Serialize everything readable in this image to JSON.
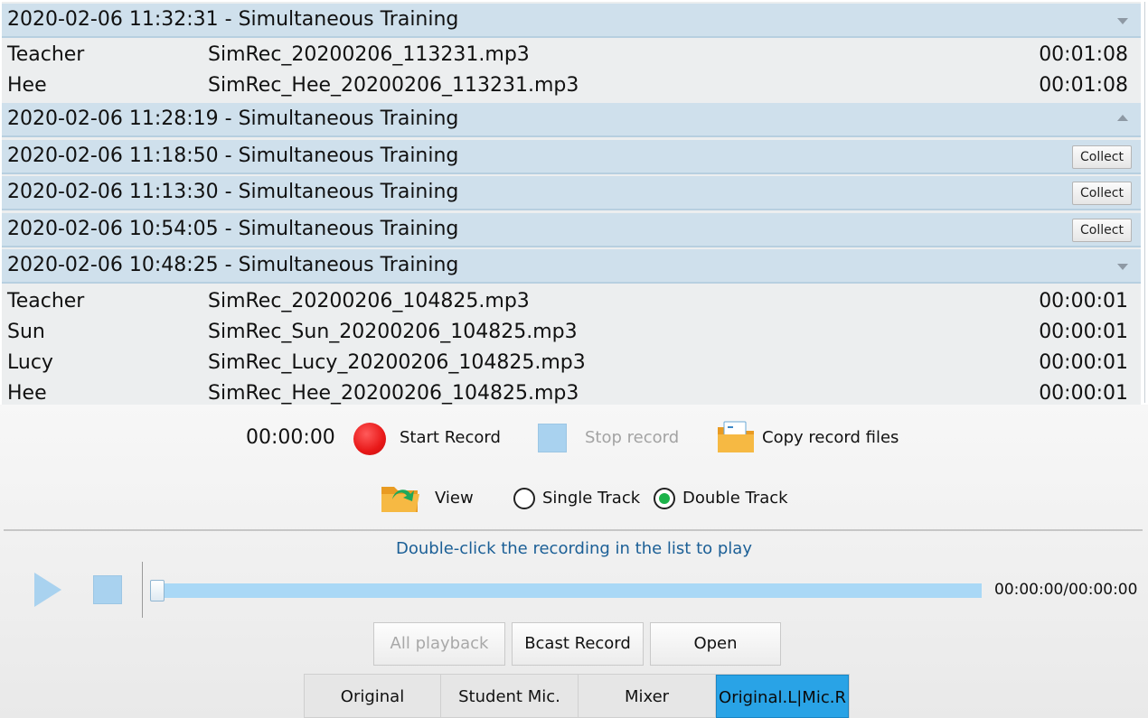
{
  "recordings": {
    "groups": [
      {
        "title": "2020-02-06 11:32:31 - Simultaneous Training",
        "state": "expanded",
        "icon": "chevron-down-icon",
        "files": [
          {
            "who": "Teacher",
            "file": "SimRec_20200206_113231.mp3",
            "duration": "00:01:08"
          },
          {
            "who": "Hee",
            "file": "SimRec_Hee_20200206_113231.mp3",
            "duration": "00:01:08"
          }
        ]
      },
      {
        "title": "2020-02-06 11:28:19 - Simultaneous Training",
        "state": "collapsed",
        "icon": "chevron-up-icon"
      },
      {
        "title": "2020-02-06 11:18:50 - Simultaneous Training",
        "state": "collapsed",
        "action": "Collect"
      },
      {
        "title": "2020-02-06 11:13:30 - Simultaneous Training",
        "state": "collapsed",
        "action": "Collect"
      },
      {
        "title": "2020-02-06 10:54:05 - Simultaneous Training",
        "state": "collapsed",
        "action": "Collect"
      },
      {
        "title": "2020-02-06 10:48:25 - Simultaneous Training",
        "state": "expanded",
        "icon": "chevron-down-icon",
        "files": [
          {
            "who": "Teacher",
            "file": "SimRec_20200206_104825.mp3",
            "duration": "00:00:01"
          },
          {
            "who": "Sun",
            "file": "SimRec_Sun_20200206_104825.mp3",
            "duration": "00:00:01"
          },
          {
            "who": "Lucy",
            "file": "SimRec_Lucy_20200206_104825.mp3",
            "duration": "00:00:01"
          },
          {
            "who": "Hee",
            "file": "SimRec_Hee_20200206_104825.mp3",
            "duration": "00:00:01"
          }
        ]
      }
    ]
  },
  "record_controls": {
    "timer": "00:00:00",
    "start_label": "Start Record",
    "stop_label": "Stop record",
    "copy_label": "Copy record files",
    "view_label": "View",
    "track_options": [
      "Single Track",
      "Double Track"
    ],
    "selected_track": "Double Track"
  },
  "player": {
    "hint": "Double-click the recording in the list to play",
    "time": "00:00:00/00:00:00",
    "progress": 0
  },
  "buttons": {
    "all_playback": "All playback",
    "bcast_record": "Bcast Record",
    "open": "Open"
  },
  "tabs": [
    "Original",
    "Student Mic.",
    "Mixer",
    "Original.L|Mic.R"
  ],
  "active_tab": "Original.L|Mic.R",
  "colors": {
    "header_bg": "#cfe0ec",
    "accent": "#29a3e6",
    "record_red": "#e81818",
    "radio_green": "#1cb34a",
    "hint_blue": "#1b5f96"
  }
}
